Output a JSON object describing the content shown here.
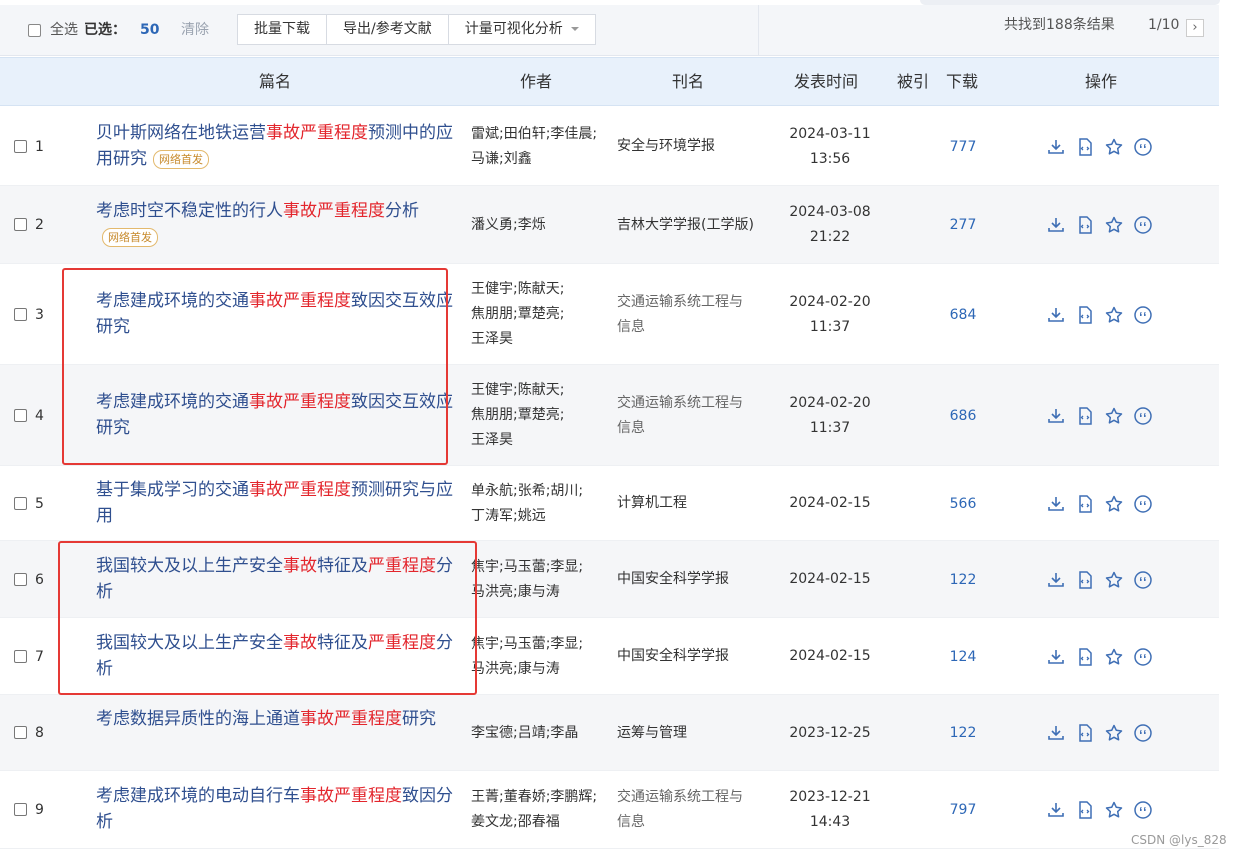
{
  "toolbar": {
    "select_all": "全选",
    "selected_label": "已选：",
    "selected_count": "50",
    "clear": "清除",
    "buttons": [
      "批量下载",
      "导出/参考文献",
      "计量可视化分析"
    ],
    "results_text": "共找到188条结果",
    "pager_text": "1/10",
    "next_icon": "chevron-right-icon"
  },
  "columns": {
    "title": "篇名",
    "author": "作者",
    "journal": "刊名",
    "date": "发表时间",
    "cited": "被引",
    "download": "下载",
    "ops": "操作"
  },
  "rows": [
    {
      "index": "1",
      "title": [
        {
          "t": "贝叶斯网络在地铁运营"
        },
        {
          "t": "事故严重程度",
          "hl": true
        },
        {
          "t": "预测中的应用研究"
        }
      ],
      "badge": "网络首发",
      "authors": [
        "雷斌;田伯轩;李佳晨;",
        "马谦;刘鑫"
      ],
      "journal": [
        "安全与环境学报"
      ],
      "date": [
        "2024-03-11",
        "13:56"
      ],
      "cited": "",
      "downloads": "777"
    },
    {
      "index": "2",
      "title": [
        {
          "t": "考虑时空不稳定性的行人"
        },
        {
          "t": "事故严重程度",
          "hl": true
        },
        {
          "t": "分析"
        }
      ],
      "badge": "网络首发",
      "authors": [
        "潘义勇;李烁"
      ],
      "journal": [
        "吉林大学学报(工学版)"
      ],
      "date": [
        "2024-03-08",
        "21:22"
      ],
      "cited": "",
      "downloads": "277"
    },
    {
      "index": "3",
      "title": [
        {
          "t": "考虑建成环境的交通"
        },
        {
          "t": "事故严重程度",
          "hl": true
        },
        {
          "t": "致因交互效应研究"
        }
      ],
      "badge": "",
      "authors": [
        "王健宇;陈献天;",
        "焦朋朋;覃楚亮;",
        "王泽昊"
      ],
      "journal": [
        "交通运输系统工程与",
        "信息"
      ],
      "date": [
        "2024-02-20",
        "11:37"
      ],
      "cited": "",
      "downloads": "684"
    },
    {
      "index": "4",
      "title": [
        {
          "t": "考虑建成环境的交通"
        },
        {
          "t": "事故严重程度",
          "hl": true
        },
        {
          "t": "致因交互效应研究"
        }
      ],
      "badge": "",
      "authors": [
        "王健宇;陈献天;",
        "焦朋朋;覃楚亮;",
        "王泽昊"
      ],
      "journal": [
        "交通运输系统工程与",
        "信息"
      ],
      "date": [
        "2024-02-20",
        "11:37"
      ],
      "cited": "",
      "downloads": "686"
    },
    {
      "index": "5",
      "title": [
        {
          "t": "基于集成学习的交通"
        },
        {
          "t": "事故严重程度",
          "hl": true
        },
        {
          "t": "预测研究与应用"
        }
      ],
      "badge": "",
      "authors": [
        "单永航;张希;胡川;",
        "丁涛军;姚远"
      ],
      "journal": [
        "计算机工程"
      ],
      "date": [
        "2024-02-15"
      ],
      "cited": "",
      "downloads": "566"
    },
    {
      "index": "6",
      "title": [
        {
          "t": "我国较大及以上生产安全"
        },
        {
          "t": "事故",
          "hl": true
        },
        {
          "t": "特征及"
        },
        {
          "t": "严重程度",
          "hl": true
        },
        {
          "t": "分析"
        }
      ],
      "badge": "",
      "authors": [
        "焦宇;马玉蕾;李显;",
        "马洪亮;康与涛"
      ],
      "journal": [
        "中国安全科学学报"
      ],
      "date": [
        "2024-02-15"
      ],
      "cited": "",
      "downloads": "122"
    },
    {
      "index": "7",
      "title": [
        {
          "t": "我国较大及以上生产安全"
        },
        {
          "t": "事故",
          "hl": true
        },
        {
          "t": "特征及"
        },
        {
          "t": "严重程度",
          "hl": true
        },
        {
          "t": "分析"
        }
      ],
      "badge": "",
      "authors": [
        "焦宇;马玉蕾;李显;",
        "马洪亮;康与涛"
      ],
      "journal": [
        "中国安全科学学报"
      ],
      "date": [
        "2024-02-15"
      ],
      "cited": "",
      "downloads": "124"
    },
    {
      "index": "8",
      "title": [
        {
          "t": "考虑数据异质性的海上通道"
        },
        {
          "t": "事故严重程度",
          "hl": true
        },
        {
          "t": "研究"
        }
      ],
      "badge": "",
      "authors": [
        "李宝德;吕靖;李晶"
      ],
      "journal": [
        "运筹与管理"
      ],
      "date": [
        "2023-12-25"
      ],
      "cited": "",
      "downloads": "122"
    },
    {
      "index": "9",
      "title": [
        {
          "t": "考虑建成环境的电动自行车"
        },
        {
          "t": "事故严重程度",
          "hl": true
        },
        {
          "t": "致因分析"
        }
      ],
      "badge": "",
      "authors": [
        "王菁;董春娇;李鹏辉;",
        "姜文龙;邵春福"
      ],
      "journal": [
        "交通运输系统工程与",
        "信息"
      ],
      "date": [
        "2023-12-21",
        "14:43"
      ],
      "cited": "",
      "downloads": "797"
    }
  ],
  "row_ops": [
    "download-icon",
    "html-read-icon",
    "favorite-star-icon",
    "cite-quote-icon"
  ],
  "watermark": "CSDN @lys_828",
  "colors": {
    "link": "#2f4f8f",
    "highlight": "#e3262d",
    "header_bg": "#e8f1fb",
    "annotation_box": "#e53935"
  }
}
